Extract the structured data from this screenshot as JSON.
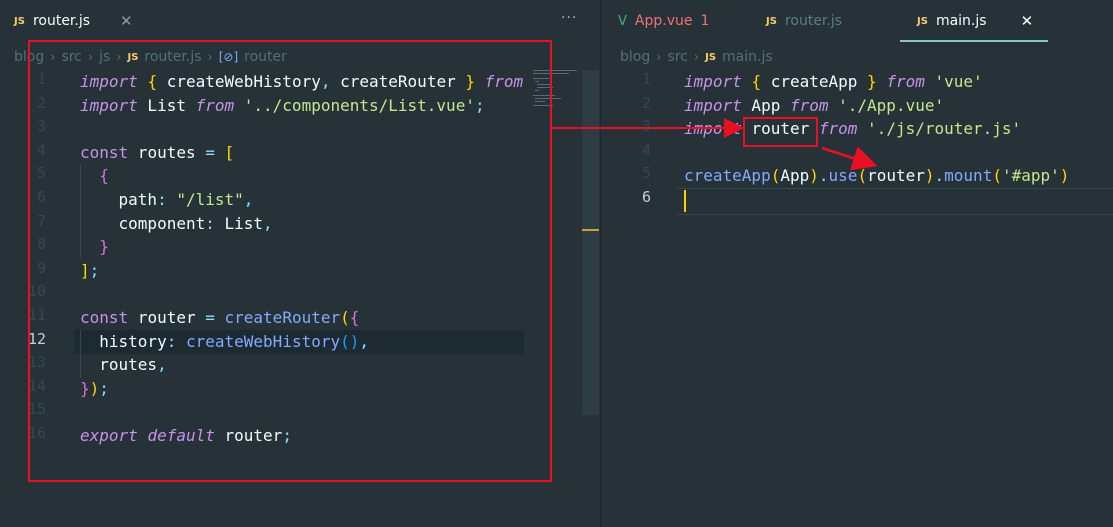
{
  "left_editor": {
    "tab": {
      "icon": "JS",
      "label": "router.js"
    },
    "more_label": "···",
    "breadcrumb": [
      "blog",
      "src",
      "js",
      "router.js",
      "router"
    ],
    "breadcrumb_icons": {
      "file": "JS",
      "symbol": "[⊘]"
    },
    "line_numbers": [
      "1",
      "2",
      "3",
      "4",
      "5",
      "6",
      "7",
      "8",
      "9",
      "10",
      "11",
      "12",
      "13",
      "14",
      "15",
      "16"
    ],
    "current_line": "12"
  },
  "right_editor": {
    "tabs": [
      {
        "icon": "V",
        "label": "App.vue",
        "badge": "1",
        "color": "#f07178"
      },
      {
        "icon": "JS",
        "label": "router.js"
      },
      {
        "icon": "JS",
        "label": "main.js",
        "active": true
      }
    ],
    "breadcrumb": [
      "blog",
      "src",
      "main.js"
    ],
    "line_numbers": [
      "1",
      "2",
      "3",
      "4",
      "5",
      "6"
    ],
    "current_line": "6",
    "highlight_word": "router"
  },
  "colors": {
    "background": "#263238",
    "keyword": "#c792ea",
    "function": "#82aaff",
    "string": "#c3e88d",
    "punctuation": "#89ddff",
    "annotation": "#e81123"
  },
  "icons": {
    "close": "close-icon",
    "more": "more-icon",
    "js": "js-file-icon",
    "vue": "vue-file-icon"
  }
}
